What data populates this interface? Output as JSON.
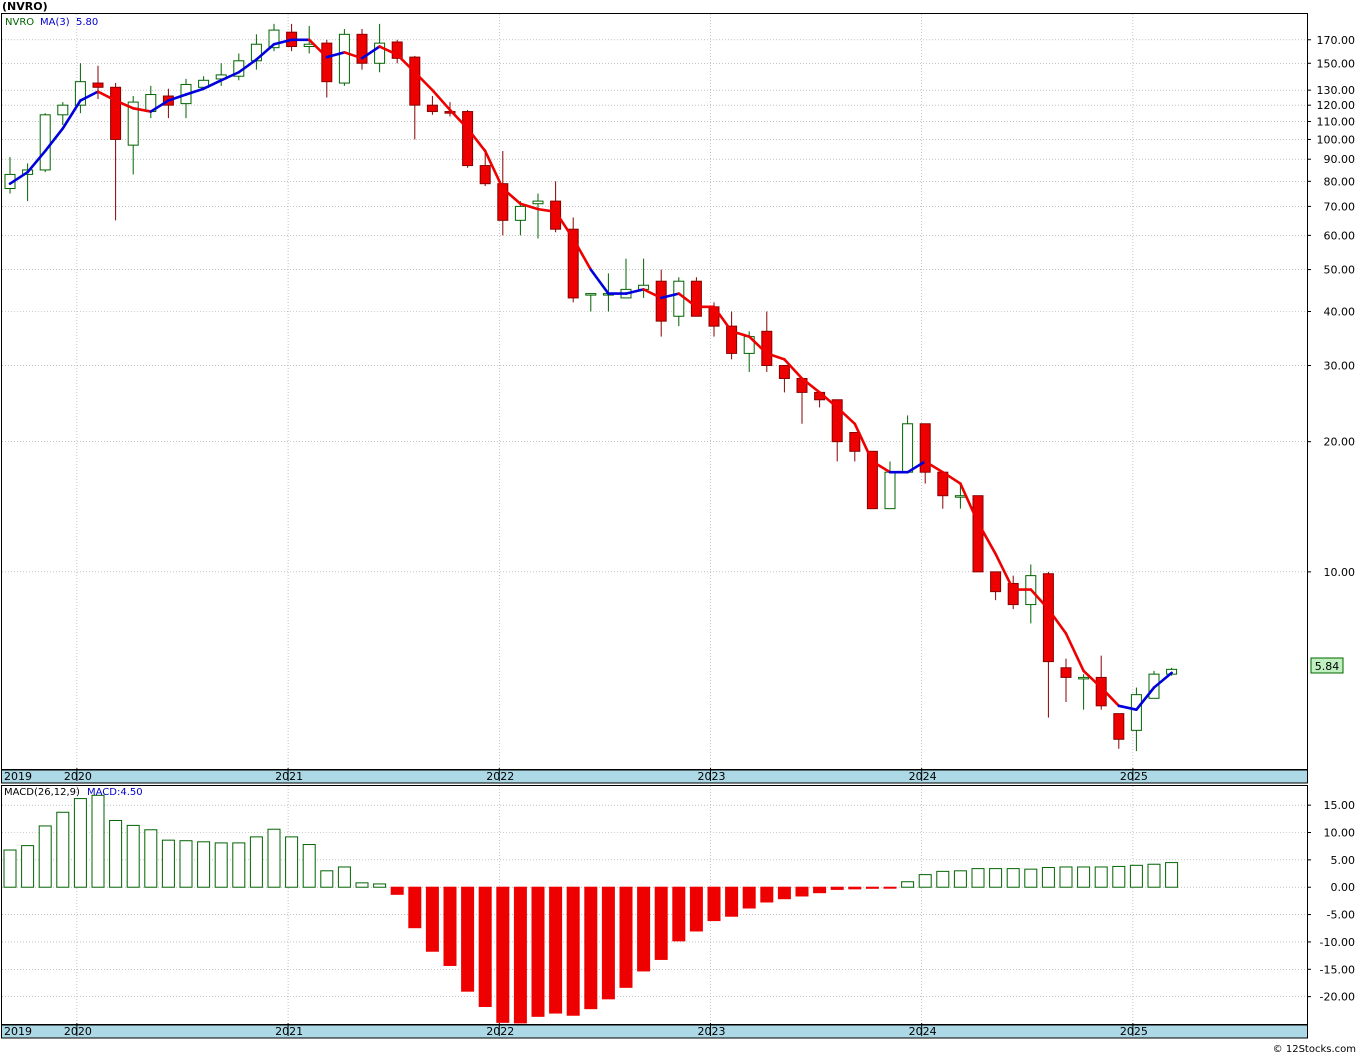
{
  "header": {
    "symbol_title": "(NVRO)",
    "legend_symbol": "NVRO",
    "legend_ma": "MA(3)",
    "legend_ma_value": "5.80",
    "macd_label": "MACD(26,12,9)",
    "macd_value": "MACD:4.50",
    "last_price_badge": "5.84",
    "copyright": "© 12Stocks.com"
  },
  "colors": {
    "up_candle_fill": "#ffffff",
    "up_candle_stroke": "#006400",
    "down_candle_fill": "#ee0000",
    "down_candle_stroke": "#880000",
    "ma_up": "#0000dd",
    "ma_down": "#ee0000",
    "macd_positive": "#006400",
    "macd_negative": "#ee0000",
    "axis_band": "#add8e6",
    "grid": "#a0a0a0",
    "badge_fill": "#c0f0c0"
  },
  "chart_data": [
    {
      "type": "candlestick",
      "title": "(NVRO)",
      "series_name": "NVRO",
      "y_scale": "log",
      "ylim": [
        3.5,
        195
      ],
      "y_ticks": [
        10,
        20,
        30,
        40,
        50,
        60,
        70,
        80,
        90,
        100,
        110,
        120,
        130,
        150,
        170
      ],
      "y_tick_labels": [
        "10.00",
        "20.00",
        "30.00",
        "40.00",
        "50.00",
        "60.00",
        "70.00",
        "80.00",
        "90.00",
        "100.00",
        "110.00",
        "120.00",
        "130.00",
        "150.00",
        "170.00"
      ],
      "x_labels": [
        "2019",
        "2020",
        "2021",
        "2022",
        "2023",
        "2024",
        "2025"
      ],
      "last_price": 5.84,
      "grid": true,
      "candles": [
        {
          "o": 77,
          "h": 91,
          "l": 75,
          "c": 83
        },
        {
          "o": 83,
          "h": 88,
          "l": 72,
          "c": 85
        },
        {
          "o": 85,
          "h": 115,
          "l": 84,
          "c": 114
        },
        {
          "o": 114,
          "h": 122,
          "l": 108,
          "c": 120
        },
        {
          "o": 120,
          "h": 150,
          "l": 115,
          "c": 136
        },
        {
          "o": 135,
          "h": 148,
          "l": 124,
          "c": 132
        },
        {
          "o": 132,
          "h": 135,
          "l": 65,
          "c": 100
        },
        {
          "o": 97,
          "h": 126,
          "l": 83,
          "c": 122
        },
        {
          "o": 116,
          "h": 133,
          "l": 112,
          "c": 127
        },
        {
          "o": 126,
          "h": 131,
          "l": 112,
          "c": 120
        },
        {
          "o": 121,
          "h": 138,
          "l": 112,
          "c": 134
        },
        {
          "o": 132,
          "h": 140,
          "l": 130,
          "c": 137
        },
        {
          "o": 138,
          "h": 150,
          "l": 133,
          "c": 141
        },
        {
          "o": 140,
          "h": 158,
          "l": 137,
          "c": 152
        },
        {
          "o": 152,
          "h": 175,
          "l": 145,
          "c": 166
        },
        {
          "o": 163,
          "h": 185,
          "l": 160,
          "c": 179
        },
        {
          "o": 177,
          "h": 185,
          "l": 160,
          "c": 164
        },
        {
          "o": 164,
          "h": 183,
          "l": 158,
          "c": 166
        },
        {
          "o": 167,
          "h": 170,
          "l": 125,
          "c": 136
        },
        {
          "o": 135,
          "h": 180,
          "l": 133,
          "c": 175
        },
        {
          "o": 175,
          "h": 180,
          "l": 145,
          "c": 150
        },
        {
          "o": 150,
          "h": 185,
          "l": 143,
          "c": 167
        },
        {
          "o": 168,
          "h": 170,
          "l": 150,
          "c": 154
        },
        {
          "o": 155,
          "h": 156,
          "l": 100,
          "c": 120
        },
        {
          "o": 120,
          "h": 126,
          "l": 114,
          "c": 116
        },
        {
          "o": 116,
          "h": 122,
          "l": 113,
          "c": 115
        },
        {
          "o": 116,
          "h": 117,
          "l": 86,
          "c": 87
        },
        {
          "o": 87,
          "h": 95,
          "l": 78,
          "c": 79
        },
        {
          "o": 79,
          "h": 94,
          "l": 60,
          "c": 65
        },
        {
          "o": 65,
          "h": 72,
          "l": 60,
          "c": 70
        },
        {
          "o": 71,
          "h": 75,
          "l": 59,
          "c": 72
        },
        {
          "o": 72,
          "h": 80,
          "l": 61,
          "c": 62
        },
        {
          "o": 62,
          "h": 66,
          "l": 42,
          "c": 43
        },
        {
          "o": 44,
          "h": 44,
          "l": 40,
          "c": 44
        },
        {
          "o": 44,
          "h": 49,
          "l": 40,
          "c": 44
        },
        {
          "o": 43,
          "h": 53,
          "l": 43,
          "c": 45
        },
        {
          "o": 45,
          "h": 53,
          "l": 43,
          "c": 46
        },
        {
          "o": 47,
          "h": 50,
          "l": 35,
          "c": 38
        },
        {
          "o": 39,
          "h": 48,
          "l": 37,
          "c": 47
        },
        {
          "o": 47,
          "h": 48,
          "l": 39,
          "c": 39
        },
        {
          "o": 41,
          "h": 42,
          "l": 35,
          "c": 37
        },
        {
          "o": 37,
          "h": 40,
          "l": 31,
          "c": 32
        },
        {
          "o": 32,
          "h": 36,
          "l": 29,
          "c": 35
        },
        {
          "o": 36,
          "h": 40,
          "l": 29,
          "c": 30
        },
        {
          "o": 30,
          "h": 30,
          "l": 26,
          "c": 28
        },
        {
          "o": 28,
          "h": 28,
          "l": 22,
          "c": 26
        },
        {
          "o": 26,
          "h": 26,
          "l": 24,
          "c": 25
        },
        {
          "o": 25,
          "h": 25,
          "l": 18,
          "c": 20
        },
        {
          "o": 21,
          "h": 21,
          "l": 18,
          "c": 19
        },
        {
          "o": 19,
          "h": 19,
          "l": 14,
          "c": 14
        },
        {
          "o": 14,
          "h": 18,
          "l": 14,
          "c": 17
        },
        {
          "o": 17,
          "h": 23,
          "l": 17,
          "c": 22
        },
        {
          "o": 22,
          "h": 22,
          "l": 16,
          "c": 17
        },
        {
          "o": 17,
          "h": 17,
          "l": 14,
          "c": 15
        },
        {
          "o": 15,
          "h": 16,
          "l": 14,
          "c": 15
        },
        {
          "o": 15,
          "h": 15,
          "l": 10,
          "c": 10
        },
        {
          "o": 10,
          "h": 10,
          "l": 8.6,
          "c": 9
        },
        {
          "o": 9.4,
          "h": 9.8,
          "l": 8.2,
          "c": 8.4
        },
        {
          "o": 8.4,
          "h": 10.4,
          "l": 7.6,
          "c": 9.8
        },
        {
          "o": 9.9,
          "h": 10,
          "l": 4.6,
          "c": 6.2
        },
        {
          "o": 6.0,
          "h": 6.3,
          "l": 5.0,
          "c": 5.7
        },
        {
          "o": 5.7,
          "h": 5.8,
          "l": 4.8,
          "c": 5.7
        },
        {
          "o": 5.7,
          "h": 6.4,
          "l": 4.8,
          "c": 4.9
        },
        {
          "o": 4.7,
          "h": 4.7,
          "l": 3.9,
          "c": 4.1
        },
        {
          "o": 4.3,
          "h": 5.4,
          "l": 3.85,
          "c": 5.2
        },
        {
          "o": 5.1,
          "h": 5.9,
          "l": 5.1,
          "c": 5.8
        },
        {
          "o": 5.8,
          "h": 6.0,
          "l": 5.75,
          "c": 5.95
        }
      ],
      "ma3": [
        79,
        84,
        94,
        106,
        123,
        129,
        123,
        118,
        116,
        123,
        127,
        131,
        137,
        143,
        153,
        166,
        170,
        170,
        155,
        159,
        154,
        164,
        157,
        143,
        130,
        117,
        106,
        94,
        77,
        71,
        69,
        68,
        59,
        50,
        44,
        44,
        45,
        43,
        44,
        41,
        41,
        36,
        35,
        32,
        31,
        28,
        26,
        24,
        22,
        18,
        17,
        17,
        18,
        17,
        16,
        13,
        11,
        9.1,
        9.1,
        8.2,
        7.2,
        5.9,
        5.4,
        4.9,
        4.8,
        5.4,
        5.84
      ],
      "ma3_direction": [
        "up",
        "up",
        "up",
        "up",
        "up",
        "up",
        "down",
        "down",
        "down",
        "up",
        "up",
        "up",
        "up",
        "up",
        "up",
        "up",
        "up",
        "up",
        "down",
        "up",
        "down",
        "up",
        "down",
        "down",
        "down",
        "down",
        "down",
        "down",
        "down",
        "down",
        "down",
        "down",
        "down",
        "down",
        "up",
        "up",
        "up",
        "down",
        "up",
        "down",
        "down",
        "down",
        "down",
        "down",
        "down",
        "down",
        "down",
        "down",
        "down",
        "down",
        "down",
        "up",
        "up",
        "down",
        "down",
        "down",
        "down",
        "down",
        "down",
        "down",
        "down",
        "down",
        "down",
        "down",
        "up",
        "up",
        "up"
      ]
    },
    {
      "type": "bar",
      "title": "MACD(26,12,9)",
      "series_name": "MACD",
      "last_value": 4.5,
      "ylim": [
        -25,
        18.5
      ],
      "y_ticks": [
        15,
        10,
        5,
        0,
        -5,
        -10,
        -15,
        -20
      ],
      "y_tick_labels": [
        "15.00",
        "10.00",
        "5.00",
        "0.00",
        "-5.00",
        "-10.00",
        "-15.00",
        "-20.00"
      ],
      "x_labels": [
        "2019",
        "2020",
        "2021",
        "2022",
        "2023",
        "2024",
        "2025"
      ],
      "grid": true,
      "values": [
        6.8,
        7.6,
        11.2,
        13.7,
        16.2,
        16.8,
        12.2,
        11.3,
        10.5,
        8.6,
        8.5,
        8.3,
        8.1,
        8.1,
        9.2,
        10.6,
        9.2,
        7.8,
        3.0,
        3.7,
        0.8,
        0.6,
        -1.3,
        -7.4,
        -11.7,
        -14.3,
        -19.0,
        -21.8,
        -24.7,
        -24.8,
        -23.6,
        -23.0,
        -23.4,
        -22.2,
        -20.4,
        -18.3,
        -15.3,
        -13.2,
        -9.8,
        -8.0,
        -6.1,
        -5.3,
        -3.8,
        -2.7,
        -2.1,
        -1.6,
        -1.0,
        -0.4,
        -0.3,
        -0.2,
        -0.1,
        1.0,
        2.3,
        2.9,
        3.0,
        3.4,
        3.4,
        3.4,
        3.3,
        3.6,
        3.7,
        3.7,
        3.7,
        3.8,
        4.0,
        4.2,
        4.5
      ]
    }
  ]
}
